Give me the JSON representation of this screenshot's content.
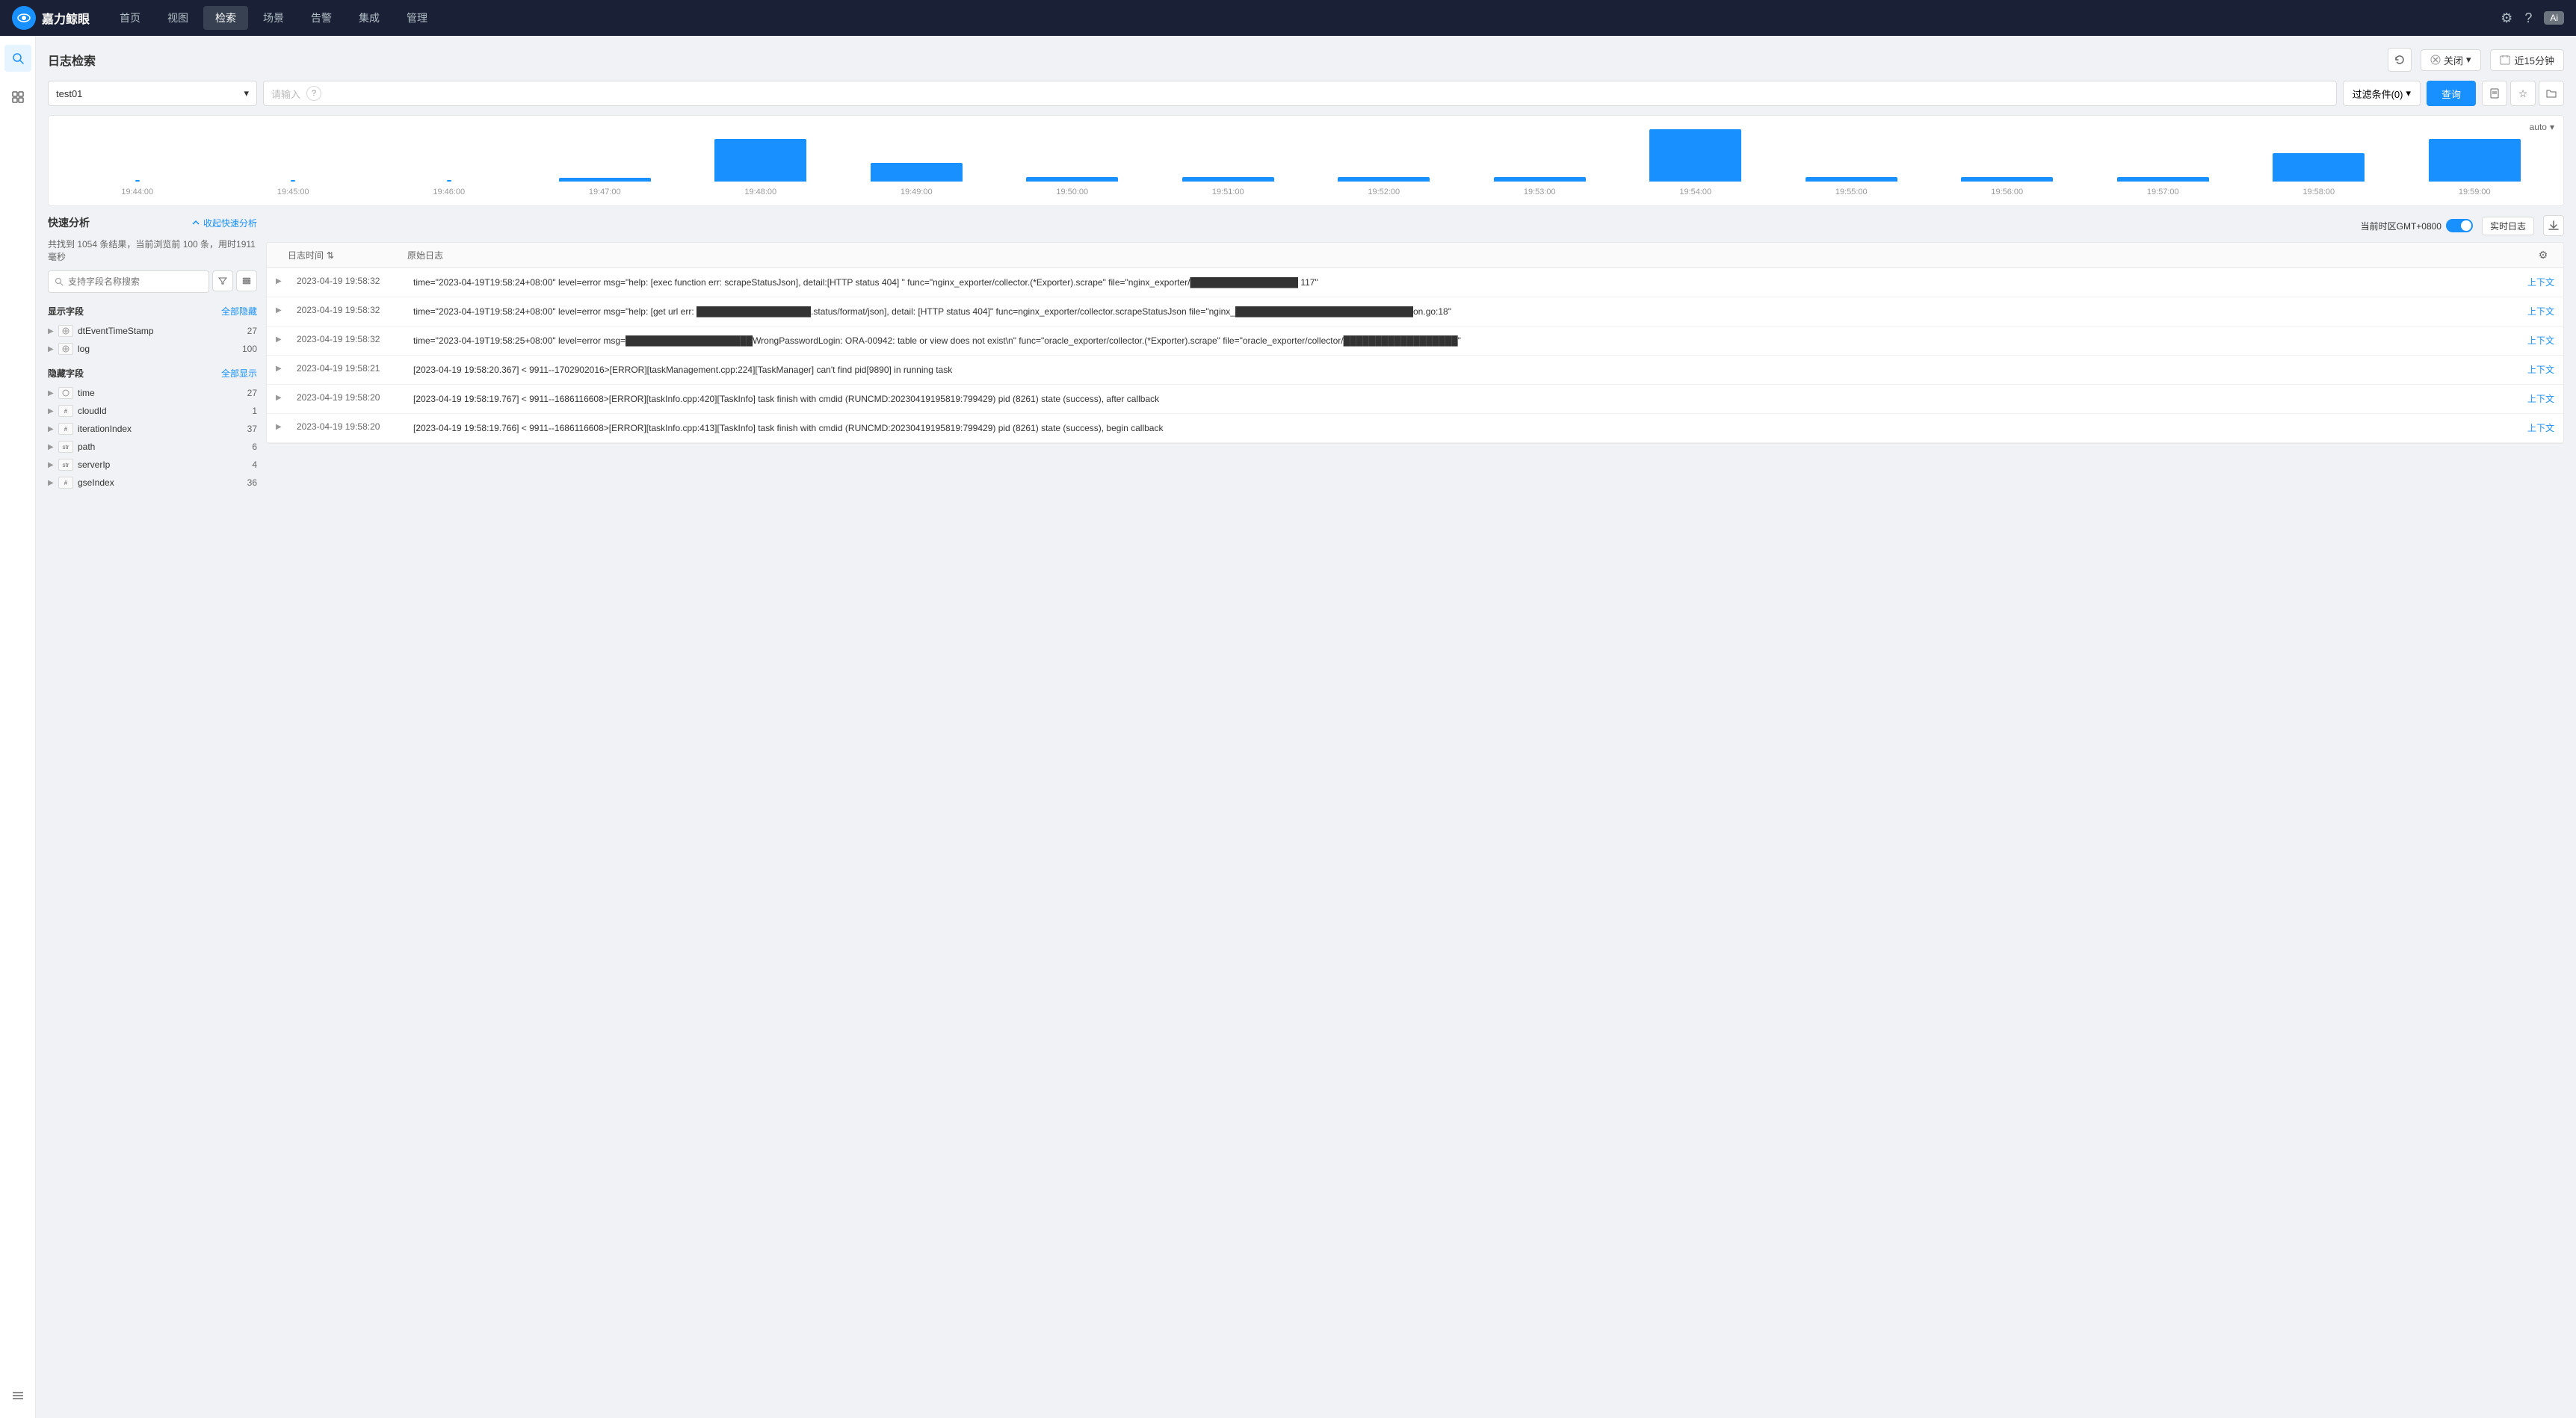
{
  "topnav": {
    "logo_text": "嘉力鲸眼",
    "items": [
      {
        "label": "首页",
        "active": false
      },
      {
        "label": "视图",
        "active": false
      },
      {
        "label": "检索",
        "active": true
      },
      {
        "label": "场景",
        "active": false
      },
      {
        "label": "告警",
        "active": false
      },
      {
        "label": "集成",
        "active": false
      },
      {
        "label": "管理",
        "active": false
      }
    ],
    "user_label": "Ai"
  },
  "page": {
    "title": "日志检索",
    "refresh_title": "刷新",
    "close_label": "关闭",
    "time_label": "近15分钟",
    "index_placeholder": "test01",
    "search_placeholder": "请输入",
    "filter_label": "过滤条件(0)",
    "query_label": "查询",
    "auto_label": "auto"
  },
  "chart": {
    "time_labels": [
      "19:44:00",
      "19:45:00",
      "19:46:00",
      "19:47:00",
      "19:48:00",
      "19:49:00",
      "19:50:00",
      "19:51:00",
      "19:52:00",
      "19:53:00",
      "19:54:00",
      "19:55:00",
      "19:56:00",
      "19:57:00",
      "19:58:00",
      "19:59:00"
    ],
    "bar_heights": [
      0,
      2,
      2,
      4,
      45,
      20,
      5,
      5,
      5,
      5,
      55,
      5,
      5,
      5,
      30,
      45
    ]
  },
  "quick_analysis": {
    "title": "快速分析",
    "collapse_label": "收起快速分析",
    "total": "1054",
    "current": "100",
    "time_ms": "1911",
    "stats_text": "共找到 1054 条结果，当前浏览前 100 条，用时1911毫秒",
    "search_placeholder": "支持字段名称搜索",
    "display_fields_title": "显示字段",
    "display_fields_action": "全部隐藏",
    "hidden_fields_title": "隐藏字段",
    "hidden_fields_action": "全部显示",
    "display_fields": [
      {
        "type": "t",
        "name": "dtEventTimeStamp",
        "count": "27"
      },
      {
        "type": "t",
        "name": "log",
        "count": "100"
      }
    ],
    "hidden_fields": [
      {
        "type": "t",
        "name": "time",
        "count": "27"
      },
      {
        "type": "#",
        "name": "cloudId",
        "count": "1"
      },
      {
        "type": "#",
        "name": "iterationIndex",
        "count": "37"
      },
      {
        "type": "str",
        "name": "path",
        "count": "6"
      },
      {
        "type": "str",
        "name": "serverIp",
        "count": "4"
      },
      {
        "type": "#",
        "name": "gseIndex",
        "count": "36"
      }
    ]
  },
  "log_results": {
    "timezone": "当前时区GMT+0800",
    "realtime_label": "实时日志",
    "col_time": "日志时间",
    "col_content": "原始日志",
    "rows": [
      {
        "time": "2023-04-19 19:58:32",
        "content": "time=\"2023-04-19T19:58:24+08:00\" level=error msg=\"help: [exec function err: scrapeStatusJson], detail:[HTTP status 404] \" func=\"nginx_exporter/collector.(*Exporter).scrape\" file=\"nginx_exporter/█████████████████ 117\"",
        "link": "上下文"
      },
      {
        "time": "2023-04-19 19:58:32",
        "content": "time=\"2023-04-19T19:58:24+08:00\" level=error msg=\"help: [get url err: ██████████████████.status/format/json], detail: [HTTP status 404]\" func=nginx_exporter/collector.scrapeStatusJson file=\"nginx_████████████████████████████on.go:18\"",
        "link": "上下文"
      },
      {
        "time": "2023-04-19 19:58:32",
        "content": "time=\"2023-04-19T19:58:25+08:00\" level=error msg=████████████████████WrongPasswordLogin: ORA-00942: table or view does not exist\\n\" func=\"oracle_exporter/collector.(*Exporter).scrape\" file=\"oracle_exporter/collector/██████████████████\"",
        "link": "上下文"
      },
      {
        "time": "2023-04-19 19:58:21",
        "content": "[2023-04-19 19:58:20.367] < 9911--1702902016>[ERROR][taskManagement.cpp:224][TaskManager] can't find pid[9890] in running task",
        "link": "上下文"
      },
      {
        "time": "2023-04-19 19:58:20",
        "content": "[2023-04-19 19:58:19.767] < 9911--1686116608>[ERROR][taskInfo.cpp:420][TaskInfo] task finish with cmdid (RUNCMD:20230419195819:799429) pid (8261) state (success), after callback",
        "link": "上下文"
      },
      {
        "time": "2023-04-19 19:58:20",
        "content": "[2023-04-19 19:58:19.766] < 9911--1686116608>[ERROR][taskInfo.cpp:413][TaskInfo] task finish with cmdid (RUNCMD:20230419195819:799429) pid (8261) state (success), begin callback",
        "link": "上下文"
      }
    ]
  }
}
